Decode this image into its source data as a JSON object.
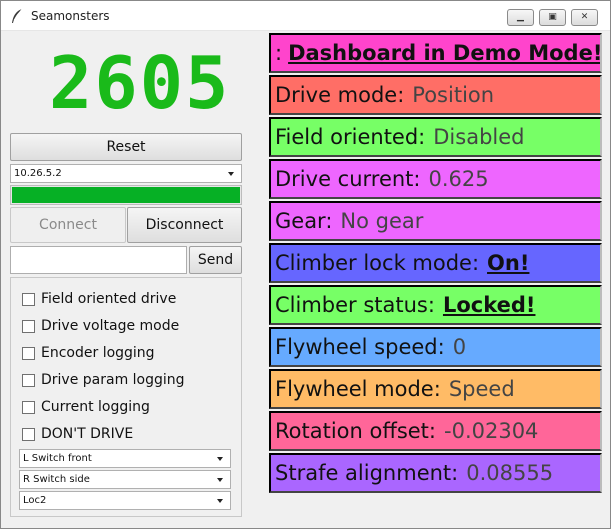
{
  "window": {
    "title": "Seamonsters",
    "controls": [
      "minimize",
      "maximize",
      "close"
    ]
  },
  "counter": "2605",
  "reset_label": "Reset",
  "ip_select": {
    "value": "10.26.5.2"
  },
  "progress": {
    "value_fraction": 1.0,
    "color": "#06b025"
  },
  "connect_label": "Connect",
  "disconnect_label": "Disconnect",
  "send_input": {
    "value": "",
    "placeholder": ""
  },
  "send_label": "Send",
  "options": [
    {
      "label": "Field oriented drive",
      "checked": false
    },
    {
      "label": "Drive voltage mode",
      "checked": false
    },
    {
      "label": "Encoder logging",
      "checked": false
    },
    {
      "label": "Drive param logging",
      "checked": false
    },
    {
      "label": "Current logging",
      "checked": false
    },
    {
      "label": "DON'T DRIVE",
      "checked": false
    }
  ],
  "dropdowns": [
    {
      "value": "L Switch front"
    },
    {
      "value": "R Switch side"
    },
    {
      "value": "Loc2"
    }
  ],
  "status": [
    {
      "label": ":",
      "value": "Dashboard in Demo Mode!",
      "color": "#ff44cc",
      "strong": true
    },
    {
      "label": "Drive mode:",
      "value": "Position",
      "color": "#ff6e66",
      "strong": false
    },
    {
      "label": "Field oriented:",
      "value": "Disabled",
      "color": "#77ff66",
      "strong": false
    },
    {
      "label": "Drive current:",
      "value": "0.625",
      "color": "#ee66ff",
      "strong": false
    },
    {
      "label": "Gear:",
      "value": "No gear",
      "color": "#ee66ff",
      "strong": false
    },
    {
      "label": "Climber lock mode:",
      "value": "On!",
      "color": "#6666ff",
      "strong": true
    },
    {
      "label": "Climber status:",
      "value": "Locked!",
      "color": "#77ff66",
      "strong": true
    },
    {
      "label": "Flywheel speed:",
      "value": "0",
      "color": "#66aaff",
      "strong": false
    },
    {
      "label": "Flywheel mode:",
      "value": "Speed",
      "color": "#ffbb66",
      "strong": false
    },
    {
      "label": "Rotation offset:",
      "value": "-0.02304",
      "color": "#ff6699",
      "strong": false
    },
    {
      "label": "Strafe alignment:",
      "value": "0.08555",
      "color": "#aa66ff",
      "strong": false
    }
  ]
}
